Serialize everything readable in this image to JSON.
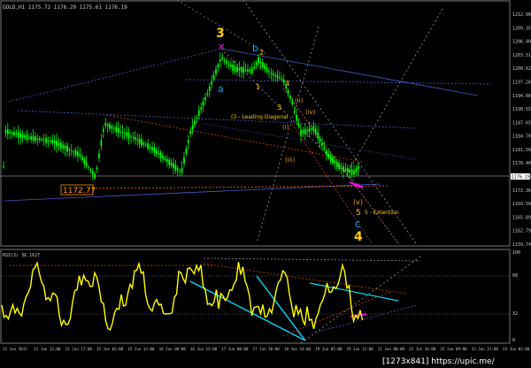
{
  "header": {
    "symbol_line": "GOLD,H1  1175.72  1176.29  1175.61  1176.19"
  },
  "price_axis": {
    "labels": [
      "1212.90",
      "1209.35",
      "1206.40",
      "1203.51",
      "1200.62",
      "1197.26",
      "1194.00",
      "1190.55",
      "1187.65",
      "1184.70",
      "1181.50",
      "1178.40",
      "1176.19",
      "1172.36",
      "1169.50",
      "1165.89",
      "1162.79",
      "1159.74"
    ],
    "current_label": "1176.19"
  },
  "wave_labels": {
    "w3": "3",
    "wb": "b",
    "w2_a": "2",
    "wa": "a",
    "w1": "1",
    "w3_small": "3",
    "w4_small": "4",
    "w_ii": "(ii)",
    "w_iv": "(iv)",
    "w_i": "(i)",
    "w_iii": "(iii)",
    "w_v_paren": "(v)",
    "w5": "5",
    "w5_ext": "5 - Extention",
    "wc": "c",
    "w4_big": "4",
    "diagonal": "(i) - Leading Diagonal"
  },
  "level_box": "1172.77",
  "rsi": {
    "title": "RSI(3) 36.1627",
    "labels": [
      "100",
      "68",
      "32",
      "0"
    ]
  },
  "time_axis": {
    "labels": [
      "11 Jun 2015",
      "11 Jun 12:00",
      "12 Jun 17:00",
      "15 Jun 03:00",
      "15 Jun 13:00",
      "16 Jun 00:00",
      "16 Jun 12:00",
      "17 Jun 00:00",
      "17 Jun 10:00",
      "18 Jun 14:00",
      "19 Jun 05:00",
      "19 Jun 12:00",
      "22 Jun 00:00",
      "22 Jun 16:00",
      "23 Jun 09:00",
      "23 Jun 21:00",
      "24 Jun 02:00"
    ]
  },
  "watermark": "[1273x841] https://upic.me/",
  "colors": {
    "bull": "#00ff00",
    "grid": "#4a4a4a",
    "yellow": "#ffff00",
    "orange": "#ff9900",
    "cyan": "#00aaff",
    "magenta": "#ff00ff",
    "blue_line": "#3a5acc"
  }
}
